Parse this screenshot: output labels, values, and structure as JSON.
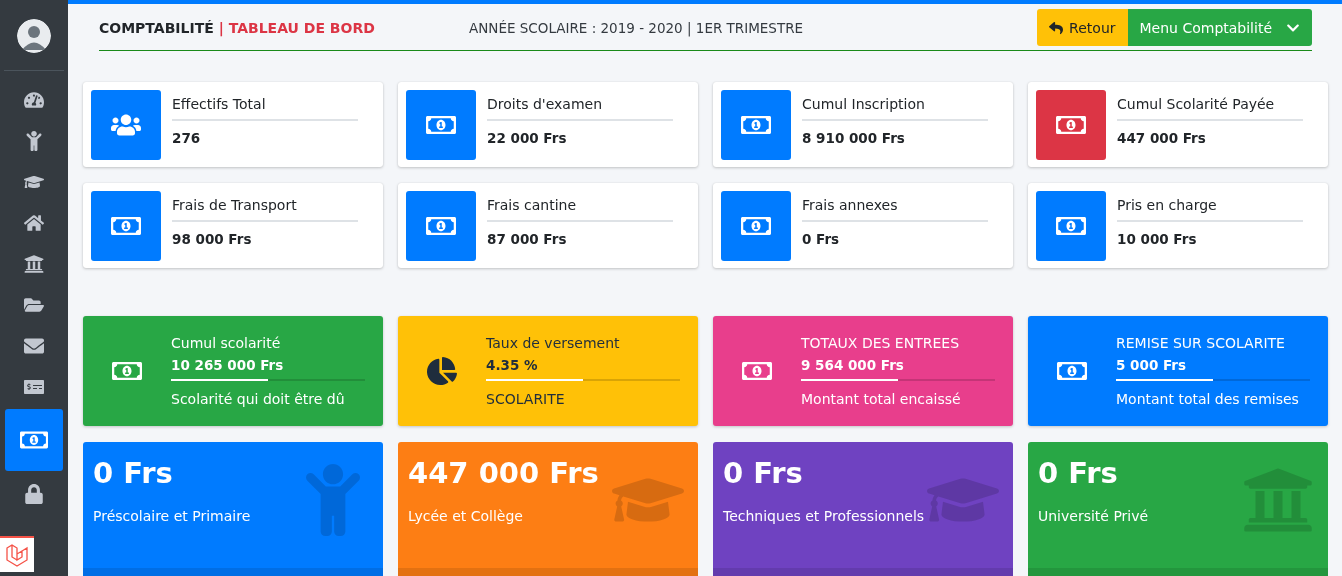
{
  "sidebar": {
    "items": [
      {
        "kind": "gauge",
        "selected": false
      },
      {
        "kind": "child",
        "selected": false
      },
      {
        "kind": "cap",
        "selected": false
      },
      {
        "kind": "home",
        "selected": false
      },
      {
        "kind": "bank",
        "selected": false
      },
      {
        "kind": "folder",
        "selected": false
      },
      {
        "kind": "mail",
        "selected": false
      },
      {
        "kind": "check",
        "selected": false
      },
      {
        "kind": "bill",
        "selected": true
      },
      {
        "kind": "lock",
        "selected": false
      }
    ]
  },
  "header": {
    "section": "COMPTABILITÉ",
    "separator": "|",
    "page": "TABLEAU DE BORD",
    "period": "ANNÉE SCOLAIRE : 2019 - 2020 | 1ER TRIMESTRE"
  },
  "buttons": [
    {
      "kind": "back",
      "label": "Retour"
    },
    {
      "kind": "menu",
      "label": "Menu Comptabilité"
    }
  ],
  "stats": [
    {
      "kind": "people",
      "label": "Effectifs Total",
      "value": "276",
      "color": "#007bff"
    },
    {
      "kind": "bill",
      "label": "Droits d'examen",
      "value": "22 000 Frs",
      "color": "#007bff"
    },
    {
      "kind": "bill",
      "label": "Cumul Inscription",
      "value": "8 910 000 Frs",
      "color": "#007bff"
    },
    {
      "kind": "bill",
      "label": "Cumul Scolarité Payée",
      "value": "447 000 Frs",
      "color": "#dc3545"
    },
    {
      "kind": "bill",
      "label": "Frais de Transport",
      "value": "98 000 Frs",
      "color": "#007bff"
    },
    {
      "kind": "bill",
      "label": "Frais cantine",
      "value": "87 000 Frs",
      "color": "#007bff"
    },
    {
      "kind": "bill",
      "label": "Frais annexes",
      "value": "0 Frs",
      "color": "#007bff"
    },
    {
      "kind": "bill",
      "label": "Pris en charge",
      "value": "10 000 Frs",
      "color": "#007bff"
    }
  ],
  "summary": [
    {
      "kind": "bill",
      "title": "Cumul scolarité",
      "value": "10 265 000 Frs",
      "note": "Scolarité qui doit être dû",
      "color": "#28a745",
      "level": 0.5
    },
    {
      "kind": "pie",
      "title": "Taux de versement",
      "value": "4.35 %",
      "note": "SCOLARITE",
      "color": "#ffc107",
      "level": 0.5
    },
    {
      "kind": "bill",
      "title": "TOTAUX DES ENTREES",
      "value": "9 564 000 Frs",
      "note": "Montant total encaissé",
      "color": "#e83e8c",
      "level": 0.5
    },
    {
      "kind": "bill",
      "title": "REMISE SUR SCOLARITE",
      "value": "5 000 Frs",
      "note": "Montant total des remises",
      "color": "#007bff",
      "level": 0.5
    }
  ],
  "totals": [
    {
      "kind": "child",
      "value": "0 Frs",
      "label": "Préscolaire et Primaire",
      "color": "#007bff"
    },
    {
      "kind": "cap",
      "value": "447 000 Frs",
      "label": "Lycée et Collège",
      "color": "#fd7e14"
    },
    {
      "kind": "cap",
      "value": "0 Frs",
      "label": "Techniques et Professionnels",
      "color": "#6f42c1"
    },
    {
      "kind": "bank",
      "value": "0 Frs",
      "label": "Université Privé",
      "color": "#28a745"
    }
  ]
}
